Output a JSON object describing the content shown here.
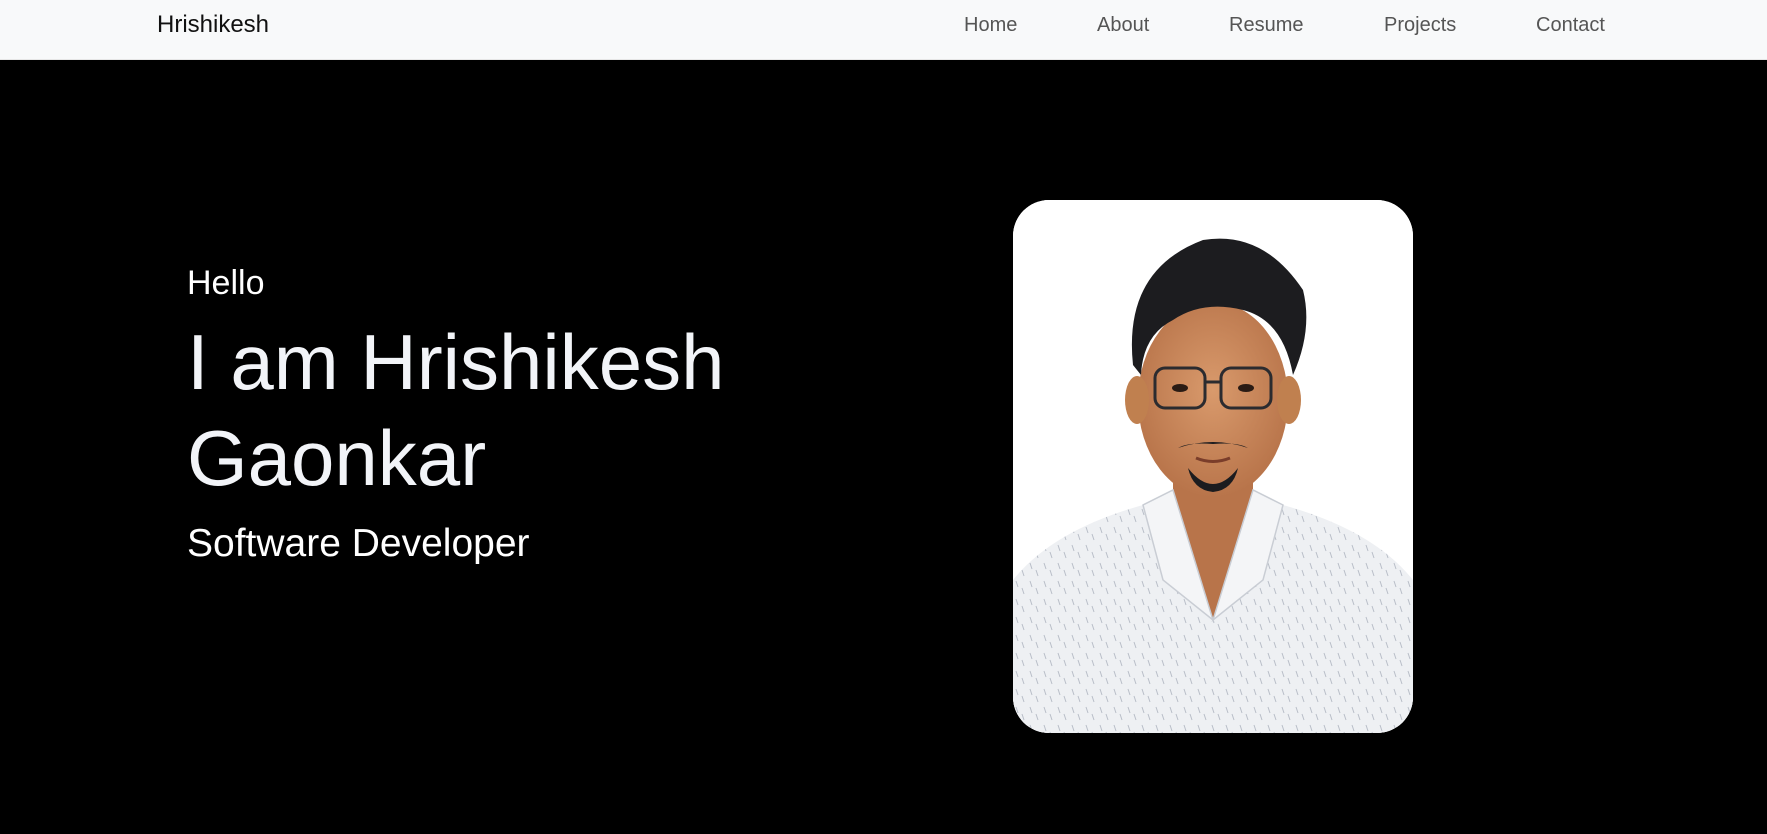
{
  "navbar": {
    "brand": "Hrishikesh",
    "links": [
      {
        "label": "Home"
      },
      {
        "label": "About"
      },
      {
        "label": "Resume"
      },
      {
        "label": "Projects"
      },
      {
        "label": "Contact"
      }
    ],
    "background": "#f8f9fa"
  },
  "hero": {
    "greeting": "Hello",
    "name_line": "I am Hrishikesh Gaonkar",
    "role": "Software Developer",
    "background": "#000000",
    "text_color": "#ffffff"
  },
  "portrait": {
    "icon": "profile-photo"
  }
}
